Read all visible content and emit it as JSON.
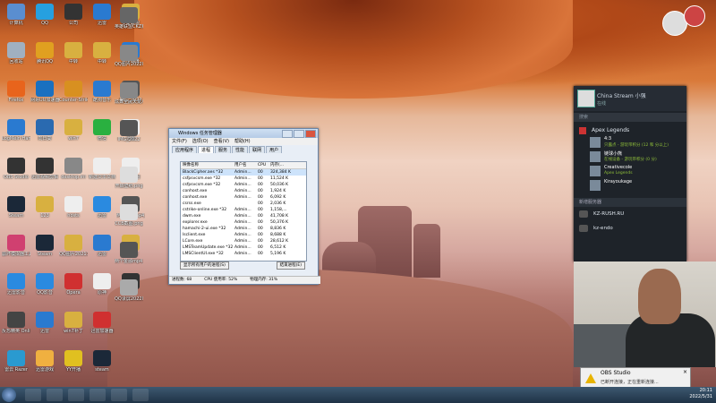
{
  "desktop_icons": [
    {
      "label": "计算机",
      "color": "#5a8ed0"
    },
    {
      "label": "回收站",
      "color": "#a0b0c0"
    },
    {
      "label": "Firefox",
      "color": "#e8641c"
    },
    {
      "label": "LogMeIn Hamachi",
      "color": "#2a7ad0"
    },
    {
      "label": "OBS Studio",
      "color": "#333"
    },
    {
      "label": "Steam",
      "color": "#1b2838"
    },
    {
      "label": "崩坏模拟器工具",
      "color": "#d04070"
    },
    {
      "label": "迅雷影音",
      "color": "#2a8ae0"
    },
    {
      "label": "反恐精英 Online",
      "color": "#444"
    },
    {
      "label": "雷云 Razer",
      "color": "#2a9ad0"
    },
    {
      "label": "QQ",
      "color": "#26a0e0"
    },
    {
      "label": "腾讯QQ",
      "color": "#e0a020"
    },
    {
      "label": "网易UU加速器",
      "color": "#1a70c0"
    },
    {
      "label": "向日葵",
      "color": "#2a6ab0"
    },
    {
      "label": "迅雷视频剪辑",
      "color": "#333"
    },
    {
      "label": "123",
      "color": "#d8b040"
    },
    {
      "label": "Steam",
      "color": "#1b2838"
    },
    {
      "label": "QQ影音",
      "color": "#2a8ae0"
    },
    {
      "label": "迅雷",
      "color": "#2a7ad0"
    },
    {
      "label": "迅雷游戏",
      "color": "#f0b040"
    },
    {
      "label": "公司",
      "color": "#333"
    },
    {
      "label": "中转",
      "color": "#d8b040"
    },
    {
      "label": "Counter-Strike Global Off...",
      "color": "#d89020"
    },
    {
      "label": "win7",
      "color": "#d8b040"
    },
    {
      "label": "desktop.ini",
      "color": "#888"
    },
    {
      "label": "hosts",
      "color": "#eee"
    },
    {
      "label": "QQ图片20211231",
      "color": "#d8b040"
    },
    {
      "label": "Opera",
      "color": "#d03030"
    },
    {
      "label": "win7补丁",
      "color": "#d8b040"
    },
    {
      "label": "YY开播",
      "color": "#e0c020"
    },
    {
      "label": "迅雷",
      "color": "#2a7ad0"
    },
    {
      "label": "中转",
      "color": "#d8b040"
    },
    {
      "label": "酷狗音乐",
      "color": "#2a7ad0"
    },
    {
      "label": "微信",
      "color": "#2ab040"
    },
    {
      "label": "新建文本文档",
      "color": "#eee"
    },
    {
      "label": "迅雷",
      "color": "#2a8ae0"
    },
    {
      "label": "迅雷",
      "color": "#2a7ad0"
    },
    {
      "label": "原神",
      "color": "#eee"
    },
    {
      "label": "迅雷加速器",
      "color": "#d03030"
    },
    {
      "label": "steam",
      "color": "#1b2838"
    },
    {
      "label": "英雄联盟",
      "color": "#d8b040"
    },
    {
      "label": "百度网盘",
      "color": "#2a7ad0"
    },
    {
      "label": "IMG_2022",
      "color": "#555"
    },
    {
      "label": "迅雷",
      "color": "#eee"
    },
    {
      "label": "CCB截图",
      "color": "#eee"
    },
    {
      "label": "两个金融mp4_2022",
      "color": "#555"
    },
    {
      "label": "QQ图片",
      "color": "#d8b040"
    },
    {
      "label": "PUBG",
      "color": "#333"
    }
  ],
  "desktop_icons_right": [
    {
      "label": "英雄联盟CKZ封面.png",
      "color": "#666"
    },
    {
      "label": "QQ图片20220515",
      "color": "#888"
    },
    {
      "label": "炫舞全民天龙八部",
      "color": "#888"
    },
    {
      "label": "IMG_2022",
      "color": "#555"
    },
    {
      "label": "开启壁纸.png",
      "color": "#ddd"
    },
    {
      "label": "CCB截图.png",
      "color": "#ddd"
    },
    {
      "label": "两个金融mp4_2022",
      "color": "#555"
    },
    {
      "label": "QQ录屏20220515.png",
      "color": "#aaa"
    }
  ],
  "task_manager": {
    "title": "Windows 任务管理器",
    "menu": [
      "文件(F)",
      "选项(O)",
      "查看(V)",
      "帮助(H)"
    ],
    "tabs": [
      "应用程序",
      "进程",
      "服务",
      "性能",
      "联网",
      "用户"
    ],
    "active_tab": 1,
    "columns": [
      "映像名称",
      "用户名",
      "CPU",
      "内存(..."
    ],
    "rows": [
      [
        "BlackCipher.aes *32",
        "Admin...",
        "00",
        "324,384 K"
      ],
      [
        "csfpsvcsm.exe *32",
        "Admin...",
        "00",
        "11,524 K"
      ],
      [
        "csfpsvcsm.exe *32",
        "Admin...",
        "00",
        "50,036 K"
      ],
      [
        "conhost.exe",
        "Admin...",
        "00",
        "1,924 K"
      ],
      [
        "conhost.exe",
        "Admin...",
        "00",
        "6,092 K"
      ],
      [
        "csrss.exe",
        "",
        "00",
        "2,036 K"
      ],
      [
        "cstrike-online.exe *32",
        "Admin...",
        "00",
        "1,158,..."
      ],
      [
        "dwm.exe",
        "Admin...",
        "00",
        "41,708 K"
      ],
      [
        "explorer.exe",
        "Admin...",
        "00",
        "50,376 K"
      ],
      [
        "hamachi-2-ui.exe *32",
        "Admin...",
        "00",
        "8,836 K"
      ],
      [
        "lsclient.exe",
        "Admin...",
        "00",
        "8,688 K"
      ],
      [
        "LCore.exe",
        "Admin...",
        "00",
        "28,612 K"
      ],
      [
        "LMSTeamUpdate.exe *32",
        "Admin...",
        "00",
        "6,512 K"
      ],
      [
        "LMSClientUI.exe *32",
        "Admin...",
        "00",
        "5,196 K"
      ]
    ],
    "show_all_label": "显示所有用户的进程(S)",
    "end_process_label": "结束进程(E)",
    "status": [
      "进程数: 68",
      "CPU 使用率: 52%",
      "物理内存: 31%"
    ]
  },
  "steam": {
    "user_name": "China Stream 小强",
    "user_status": "在线",
    "search_placeholder": "搜索",
    "game": "Apex Legends",
    "friends": [
      {
        "name": "4:3",
        "status": "只露点 - 游玩带积分 (12 和 分以上)"
      },
      {
        "name": "链球小熊",
        "status": "在线设备 - 游玩带积分 (0 分)"
      },
      {
        "name": "Creativecole",
        "status": "Apex Legends"
      },
      {
        "name": "Kirayoukage",
        "status": ""
      }
    ],
    "group_label": "新增服务器",
    "servers": [
      "KZ-RUSH.RU",
      "kz-endo"
    ]
  },
  "notification": {
    "title": "OBS Studio",
    "body": "已断开连接，正在重新连接..."
  },
  "tray": {
    "time": "20:11",
    "date": "2022/5/31"
  },
  "colors": {
    "taskbar": "#2a4258",
    "steam_bg": "#1e2329",
    "tm_bg": "#e8eef6"
  }
}
